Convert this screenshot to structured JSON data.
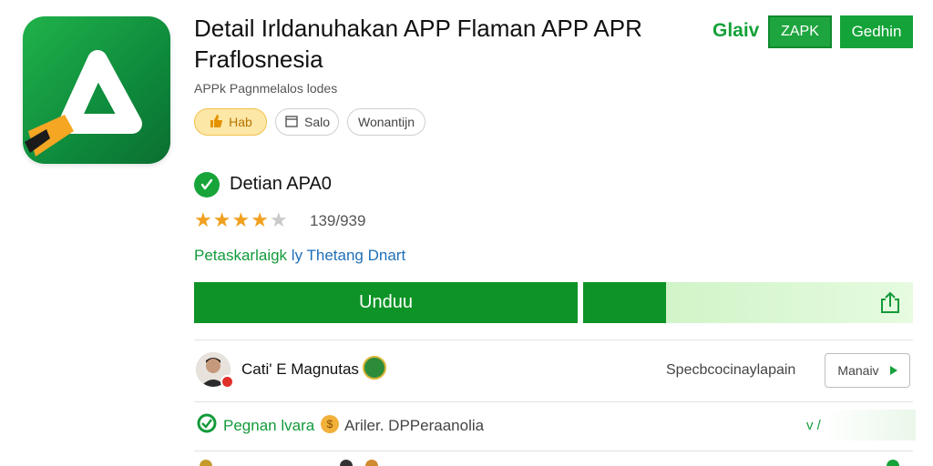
{
  "app": {
    "title": "Detail Irldanuhakan APP Flaman APP APR Fraflosnesia",
    "subtitle": "APPk Pagnmelalos lodes",
    "icon_name": "app-logo-icon",
    "chips": [
      {
        "label": "Hab",
        "icon": "thumbs-up-icon"
      },
      {
        "label": "Salo",
        "icon": "calendar-icon"
      },
      {
        "label": "Wonantijn",
        "icon": ""
      }
    ]
  },
  "header_actions": {
    "link_label": "Glaiv",
    "outline_button_label": "ZAPK",
    "solid_button_label": "Gedhin"
  },
  "verification": {
    "label": "Detian APA0",
    "icon": "check-badge-icon"
  },
  "rating": {
    "stars_filled": 4,
    "stars_total": 5,
    "count_text": "139/939"
  },
  "developer": {
    "name_part_a": "Petaskarlaigk",
    "name_part_b": "ly Thetang Dnart"
  },
  "install": {
    "button_label": "Unduu",
    "progress": 0.25,
    "share_icon": "share-icon"
  },
  "author": {
    "name": "Cati' E Magnutas",
    "side_text": "Specbcocinaylapain",
    "next_button_label": "Manaiv"
  },
  "info_row": {
    "label": "Pegnan lvara",
    "detail": "Ariler. DPPeraanolia",
    "expand_label": "v /"
  },
  "colors": {
    "brand_green": "#0e9327",
    "accent_green": "#14a338",
    "star": "#f0a020",
    "link_blue": "#1f6fb8"
  }
}
